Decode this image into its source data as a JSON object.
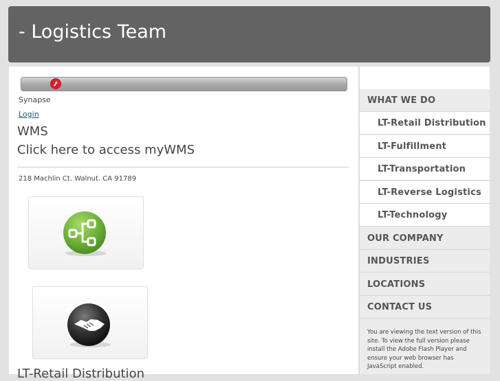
{
  "header": {
    "title": "- Logistics Team"
  },
  "content": {
    "flash_label": "Synapse",
    "login_link": "Login",
    "wms_heading": "WMS",
    "wms_link": "Click here to access myWMS",
    "address": "218 Machlin Ct. Walnut. CA 91789",
    "bottom_heading": "LT-Retail Distribution"
  },
  "sidebar": {
    "items": [
      {
        "label": "WHAT WE DO"
      },
      {
        "label": "LT-Retail Distribution"
      },
      {
        "label": "LT-Fulfillment"
      },
      {
        "label": "LT-Transportation"
      },
      {
        "label": "LT-Reverse Logistics"
      },
      {
        "label": "LT-Technology"
      },
      {
        "label": "OUR COMPANY"
      },
      {
        "label": "INDUSTRIES"
      },
      {
        "label": "LOCATIONS"
      },
      {
        "label": "CONTACT US"
      }
    ],
    "flash_note": "You are viewing the text version of this site. To view the full version please install the Adobe Flash Player and ensure your web browser has JavaScript enabled."
  },
  "colors": {
    "header_bg": "#636363",
    "page_bg": "#e2e2e2",
    "link": "#225577",
    "card1_icon": "#6fb33a",
    "card2_icon": "#333333"
  },
  "icons": {
    "flash": "adobe-flash-icon",
    "card1": "network-nodes-icon",
    "card2": "handshake-icon"
  }
}
